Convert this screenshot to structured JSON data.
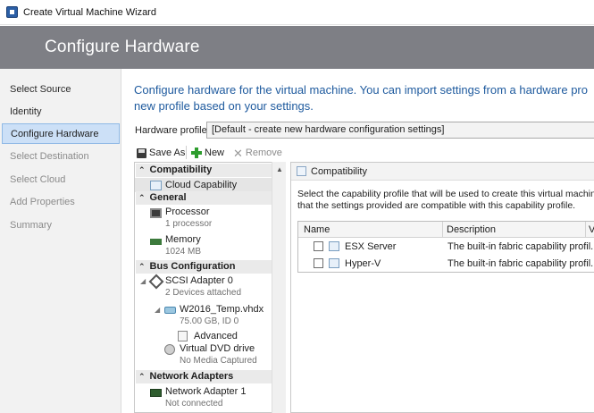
{
  "window": {
    "title": "Create Virtual Machine Wizard"
  },
  "banner": {
    "heading": "Configure Hardware"
  },
  "nav": {
    "items": [
      {
        "label": "Select Source",
        "state": "done"
      },
      {
        "label": "Identity",
        "state": "done"
      },
      {
        "label": "Configure Hardware",
        "state": "selected"
      },
      {
        "label": "Select Destination",
        "state": "disabled"
      },
      {
        "label": "Select Cloud",
        "state": "disabled"
      },
      {
        "label": "Add Properties",
        "state": "disabled"
      },
      {
        "label": "Summary",
        "state": "disabled"
      }
    ]
  },
  "main": {
    "intro_line1": "Configure hardware for the virtual machine. You can import settings from a hardware pro",
    "intro_line2": "new profile based on your settings.",
    "hardware_profile_label": "Hardware profile:",
    "hardware_profile_value": "[Default - create new hardware configuration settings]"
  },
  "toolbar": {
    "save_as": "Save As",
    "new": "New",
    "remove": "Remove"
  },
  "tree": {
    "sections": {
      "compatibility": "Compatibility",
      "general": "General",
      "bus": "Bus Configuration",
      "network": "Network Adapters"
    },
    "items": {
      "cloud_profiles": "Cloud Capability Profiles",
      "processor": "Processor",
      "processor_sub": "1 processor",
      "memory": "Memory",
      "memory_sub": "1024 MB",
      "scsi": "SCSI Adapter 0",
      "scsi_sub": "2 Devices attached",
      "vhdx": "W2016_Temp.vhdx",
      "vhdx_sub": "75.00 GB, ID 0",
      "advanced": "Advanced",
      "dvd": "Virtual DVD drive",
      "dvd_sub": "No Media Captured",
      "nic": "Network Adapter 1",
      "nic_sub": "Not connected"
    }
  },
  "detail": {
    "header": "Compatibility",
    "desc_line1": "Select the capability profile that will be used to create this virtual machine. V",
    "desc_line2": "that the settings provided are compatible with this capability profile.",
    "columns": {
      "name": "Name",
      "description": "Description",
      "v": "V"
    },
    "rows": [
      {
        "name": "ESX Server",
        "description": "The built-in fabric capability profil...",
        "checked": false
      },
      {
        "name": "Hyper-V",
        "description": "The built-in fabric capability profil...",
        "checked": false
      }
    ]
  }
}
